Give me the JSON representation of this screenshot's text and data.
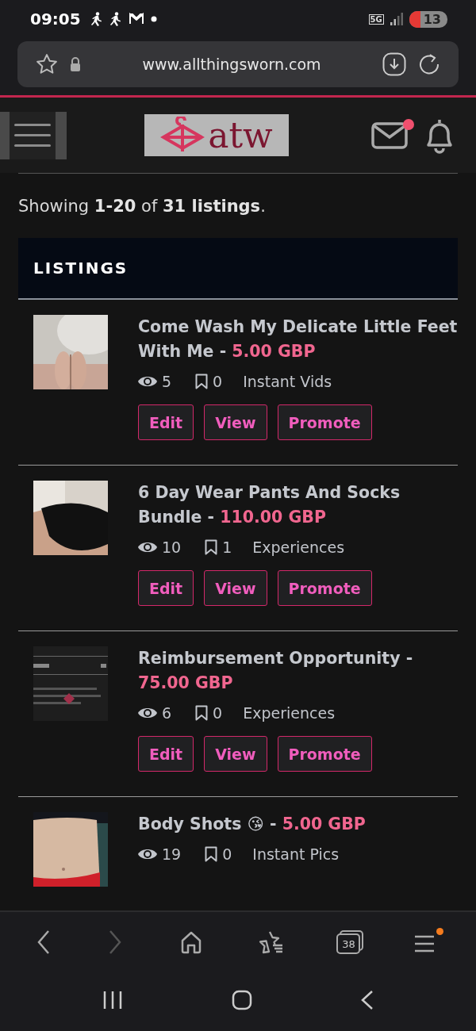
{
  "status_bar": {
    "time": "09:05",
    "network": "5G",
    "battery": "13"
  },
  "browser": {
    "url": "www.allthingsworn.com",
    "tab_count": "38",
    "forward_disabled": true,
    "menu_badge": true
  },
  "site_header": {
    "logo_text": "atw",
    "unread_messages": true
  },
  "summary": "Showing **1-20** of **31 listings**.",
  "section_title": "LISTINGS",
  "listings": [
    {
      "title": "Come Wash My Delicate Little Feet With Me",
      "separator": "-",
      "price": "5.00 GBP",
      "views": "5",
      "saves": "0",
      "category": "Instant Vids",
      "buttons": [
        "Edit",
        "View",
        "Promote"
      ]
    },
    {
      "title": "6 Day Wear Pants And Socks Bundle",
      "separator": "-",
      "price": "110.00 GBP",
      "views": "10",
      "saves": "1",
      "category": "Experiences",
      "buttons": [
        "Edit",
        "View",
        "Promote"
      ]
    },
    {
      "title": "Reimbursement Opportunity",
      "separator": "-",
      "price": "75.00 GBP",
      "views": "6",
      "saves": "0",
      "category": "Experiences",
      "buttons": [
        "Edit",
        "View",
        "Promote"
      ]
    },
    {
      "title": "Body Shots 😘",
      "separator": "-",
      "price": "5.00 GBP",
      "views": "19",
      "saves": "0",
      "category": "Instant Pics"
    }
  ]
}
